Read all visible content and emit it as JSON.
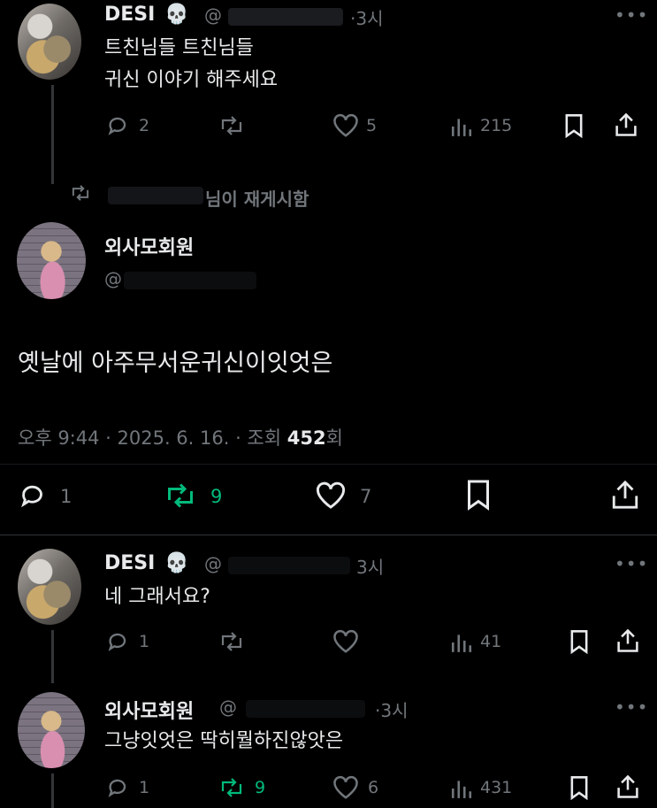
{
  "post1": {
    "name": "DESI",
    "handle": "@",
    "time": "·3시",
    "lines": [
      "트친님들 트친님들",
      "귀신 이야기 해주세요"
    ],
    "replies": "2",
    "likes": "5",
    "views": "215"
  },
  "repost_notice": "님이 재게시함",
  "main": {
    "name": "외사모회원",
    "handle": "@",
    "text": "옛날에 아주무서운귀신이잇엇은",
    "meta_time": "오후 9:44 · 2025. 6. 16. · 조회",
    "views_bold": "452",
    "views_suffix": "회",
    "replies": "1",
    "reposts": "9",
    "likes": "7"
  },
  "reply1": {
    "name": "DESI",
    "handle": "@",
    "time": "3시",
    "text": "네 그래서요?",
    "replies": "1",
    "views": "41"
  },
  "reply2": {
    "name": "외사모회원",
    "handle": "@",
    "time": "·3시",
    "text": "그냥잇엇은 딱히뭘하진않앗은",
    "replies": "1",
    "reposts": "9",
    "likes": "6",
    "views": "431"
  },
  "colors": {
    "background": "#000000",
    "text": "#e7e9ea",
    "muted": "#71767b",
    "repost_active": "#00ba7c"
  },
  "icons": [
    "skull-emoji",
    "more-icon",
    "reply-icon",
    "repost-icon",
    "like-icon",
    "views-icon",
    "bookmark-icon",
    "share-icon"
  ]
}
